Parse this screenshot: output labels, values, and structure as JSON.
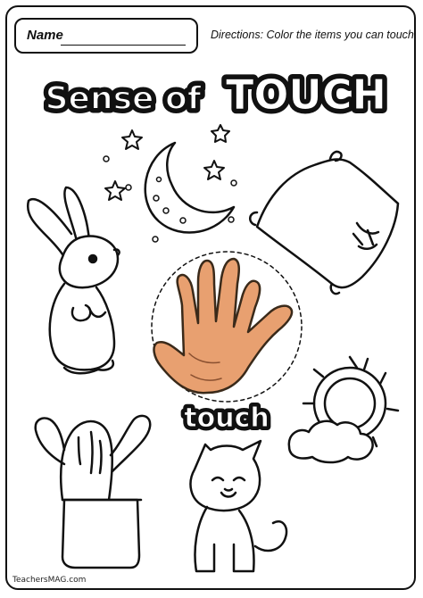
{
  "worksheet": {
    "name_label": "Name",
    "directions": "Directions: Color the items you can touch.",
    "title": {
      "part1": "Sense of",
      "part2": "TOUCH"
    },
    "center_label": "touch",
    "footer": "TeachersMAG.com"
  },
  "illustrations": [
    {
      "icon": "moon-and-stars-icon"
    },
    {
      "icon": "bunny-icon"
    },
    {
      "icon": "pillow-icon"
    },
    {
      "icon": "hand-icon"
    },
    {
      "icon": "sun-icon"
    },
    {
      "icon": "cloud-icon"
    },
    {
      "icon": "cactus-icon"
    },
    {
      "icon": "cat-icon"
    }
  ],
  "colors": {
    "hand_fill": "#E8A070",
    "outline": "#111111"
  }
}
